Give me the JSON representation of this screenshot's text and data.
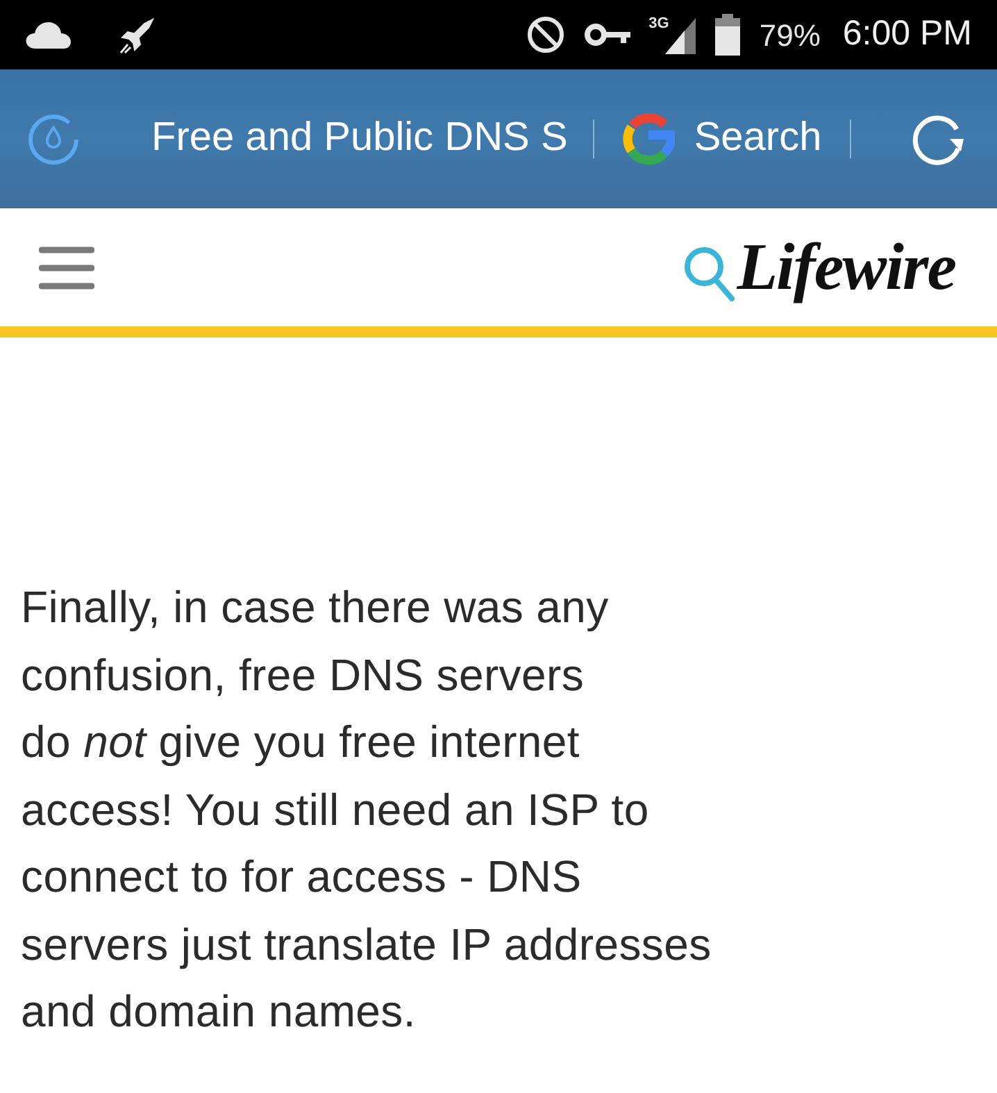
{
  "status_bar": {
    "network": "3G",
    "battery": "79%",
    "time": "6:00 PM"
  },
  "address_bar": {
    "title": "Free and Public DNS S",
    "search_label": "Search"
  },
  "site_header": {
    "logo": "Lifewire"
  },
  "article": {
    "lines": [
      "Finally, in case there was any",
      "confusion, free DNS servers",
      "do *not* give you free internet",
      "access! You still need an ISP to",
      "connect to for access - DNS",
      "servers just translate IP addresses",
      "and domain names."
    ]
  }
}
